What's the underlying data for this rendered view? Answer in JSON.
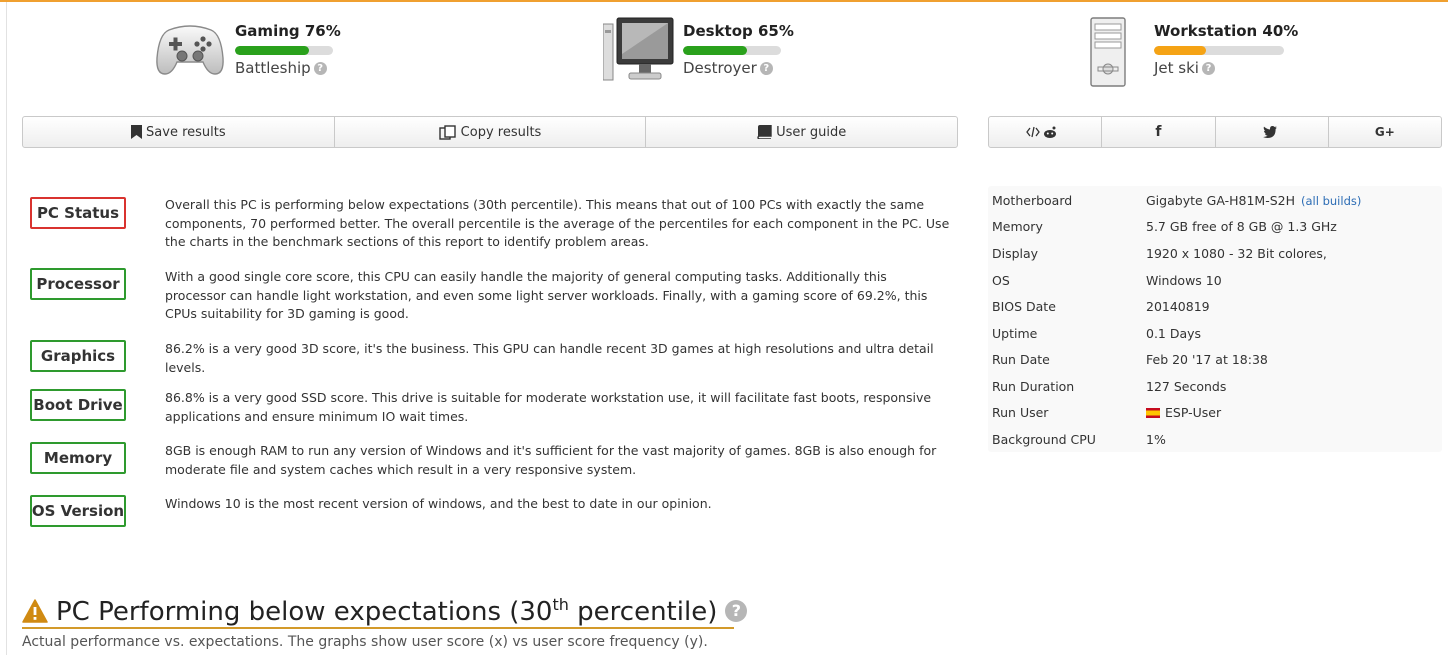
{
  "tiles": [
    {
      "score": "Gaming 76%",
      "percent": 76,
      "bar_color": "#2aa11c",
      "nickname": "Battleship",
      "icon": "gamepad-icon"
    },
    {
      "score": "Desktop 65%",
      "percent": 65,
      "bar_color": "#2aa11c",
      "nickname": "Destroyer",
      "icon": "desktop-monitor-icon"
    },
    {
      "score": "Workstation 40%",
      "percent": 40,
      "bar_color": "#f5a315",
      "nickname": "Jet ski",
      "icon": "workstation-tower-icon"
    }
  ],
  "toolbar": {
    "save_label": "Save results",
    "copy_label": "Copy results",
    "guide_label": "User guide"
  },
  "share": {
    "embed_reddit": "</> reddit",
    "facebook": "f",
    "twitter": "twitter",
    "gplus": "G+"
  },
  "status": [
    {
      "label": "PC Status",
      "state": "bad",
      "text": "Overall this PC is performing below expectations (30th percentile). This means that out of 100 PCs with exactly the same components, 70 performed better. The overall percentile is the average of the percentiles for each component in the PC. Use the charts in the benchmark sections of this report to identify problem areas."
    },
    {
      "label": "Processor",
      "state": "good",
      "text": "With a good single core score, this CPU can easily handle the majority of general computing tasks. Additionally this processor can handle light workstation, and even some light server workloads. Finally, with a gaming score of 69.2%, this CPUs suitability for 3D gaming is good."
    },
    {
      "label": "Graphics",
      "state": "good",
      "text": "86.2% is a very good 3D score, it's the business. This GPU can handle recent 3D games at high resolutions and ultra detail levels."
    },
    {
      "label": "Boot Drive",
      "state": "good",
      "text": "86.8% is a very good SSD score. This drive is suitable for moderate workstation use, it will facilitate fast boots, responsive applications and ensure minimum IO wait times."
    },
    {
      "label": "Memory",
      "state": "good",
      "text": "8GB is enough RAM to run any version of Windows and it's sufficient for the vast majority of games. 8GB is also enough for moderate file and system caches which result in a very responsive system."
    },
    {
      "label": "OS Version",
      "state": "good",
      "text": "Windows 10 is the most recent version of windows, and the best to date in our opinion."
    }
  ],
  "specs": {
    "motherboard": {
      "label": "Motherboard",
      "value": "Gigabyte GA-H81M-S2H",
      "link": "(all builds)"
    },
    "memory": {
      "label": "Memory",
      "value": "5.7 GB free of 8 GB @ 1.3 GHz"
    },
    "display": {
      "label": "Display",
      "value": "1920 x 1080 - 32 Bit colores,"
    },
    "os": {
      "label": "OS",
      "value": "Windows 10"
    },
    "bios": {
      "label": "BIOS Date",
      "value": "20140819"
    },
    "uptime": {
      "label": "Uptime",
      "value": "0.1 Days"
    },
    "run_date": {
      "label": "Run Date",
      "value": "Feb 20 '17 at 18:38"
    },
    "run_duration": {
      "label": "Run Duration",
      "value": "127 Seconds"
    },
    "run_user": {
      "label": "Run User",
      "value": "ESP-User"
    },
    "bg_cpu": {
      "label": "Background CPU",
      "value": "1%"
    }
  },
  "perf": {
    "heading_pre": "PC Performing below expectations (30",
    "heading_sup": "th",
    "heading_post": " percentile)",
    "help": "?",
    "subtitle": "Actual performance vs. expectations. The graphs show user score (x) vs user score frequency (y)."
  },
  "help_glyph": "?"
}
